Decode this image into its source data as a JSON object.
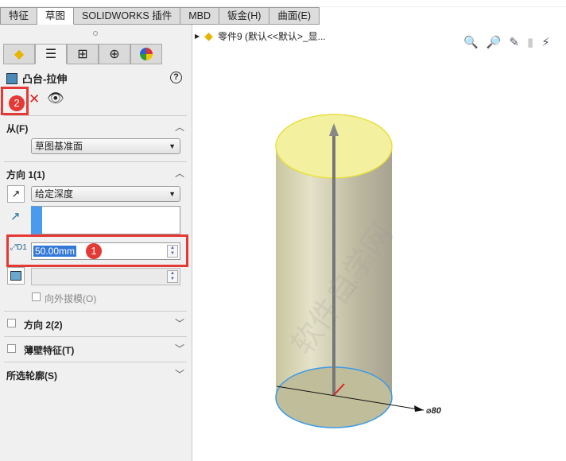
{
  "tabs": [
    "特征",
    "草图",
    "SOLIDWORKS 插件",
    "MBD",
    "钣金(H)",
    "曲面(E)"
  ],
  "tree": {
    "label": "零件9  (默认<<默认>_显..."
  },
  "panel": {
    "title": "凸台-拉伸",
    "help": "?",
    "from": {
      "label": "从(F)",
      "value": "草图基准面"
    },
    "dir1": {
      "label": "方向 1(1)",
      "type": "给定深度",
      "depth": "50.00mm",
      "draft_out": "向外拔模(O)"
    },
    "dir2": {
      "label": "方向 2(2)"
    },
    "thin": {
      "label": "薄壁特征(T)"
    },
    "contours": {
      "label": "所选轮廓(S)"
    }
  },
  "annotations": {
    "badge1": "1",
    "badge2": "2"
  },
  "view": {
    "dimension": "⌀80",
    "watermark": "软件自学网",
    "watermark_url": "RJZXW.COM"
  }
}
